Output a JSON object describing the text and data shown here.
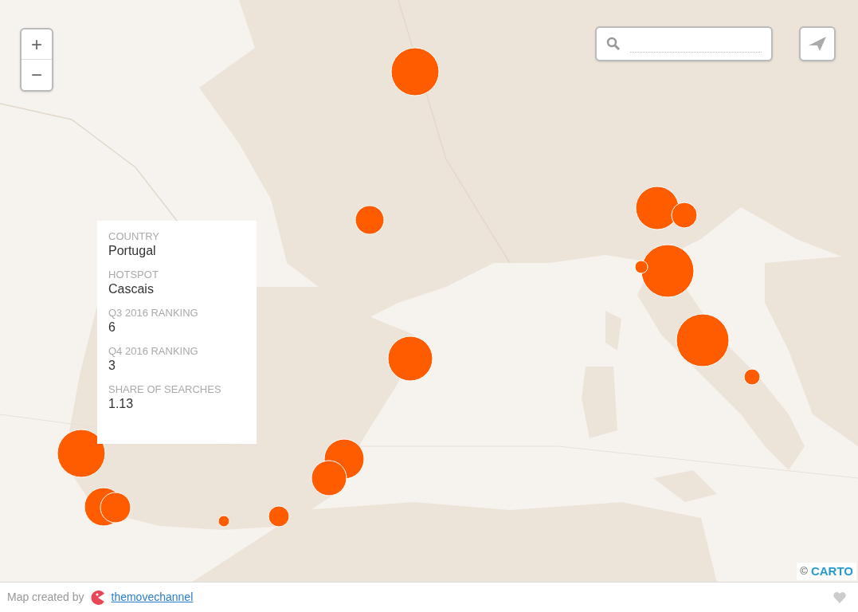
{
  "zoom_controls": {
    "zoom_in": "+",
    "zoom_out": "−"
  },
  "tooltip": {
    "fields": [
      {
        "label": "COUNTRY",
        "value": "Portugal"
      },
      {
        "label": "HOTSPOT",
        "value": "Cascais"
      },
      {
        "label": "Q3 2016 RANKING",
        "value": "6"
      },
      {
        "label": "Q4 2016 RANKING",
        "value": "3"
      },
      {
        "label": "SHARE OF SEARCHES",
        "value": "1.13"
      }
    ]
  },
  "attribution": {
    "symbol": "©",
    "link": "CARTO"
  },
  "footer": {
    "text": "Map created by",
    "author": "themovechannel"
  }
}
